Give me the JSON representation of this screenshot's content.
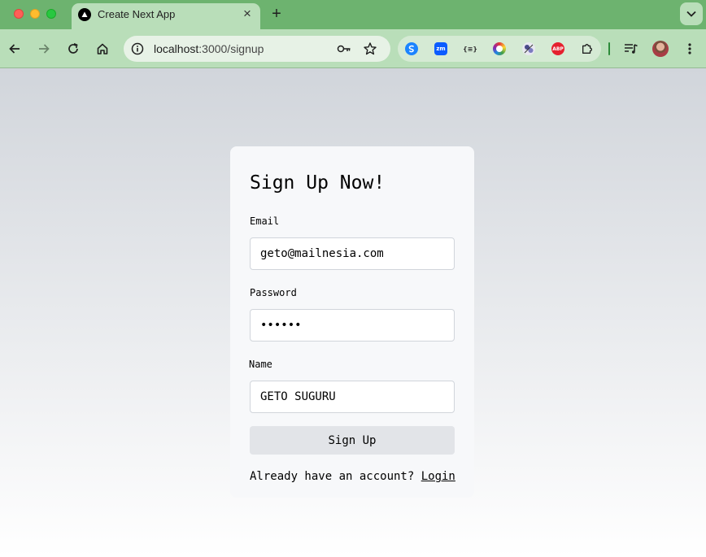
{
  "browser": {
    "tab_title": "Create Next App",
    "tab_close": "×",
    "new_tab": "+",
    "url_host": "localhost",
    "url_path": ":3000/signup",
    "icons": [
      "back-icon",
      "forward-icon",
      "reload-icon",
      "home-icon",
      "site-info-icon",
      "password-key-icon",
      "bookmark-star-icon",
      "extensions-puzzle-icon",
      "reading-list-icon",
      "tab-search-icon"
    ],
    "extensions": [
      {
        "name": "sync-ext-icon",
        "text": "S",
        "color": "#1b84ff"
      },
      {
        "name": "zoom-ext-icon",
        "text": "zm",
        "color": "#0b5cff"
      },
      {
        "name": "json-ext-icon",
        "text": "{≡}",
        "color": "#333333"
      },
      {
        "name": "color-picker-ext-icon",
        "text": "",
        "color": "#7a3bd1"
      },
      {
        "name": "scholar-ext-icon",
        "text": "",
        "color": "#555555"
      },
      {
        "name": "adblock-ext-icon",
        "text": "ABP",
        "color": "#e5202e"
      }
    ]
  },
  "form": {
    "title": "Sign Up Now!",
    "email_label": "Email",
    "email_value": "geto@mailnesia.com",
    "password_label": "Password",
    "password_value": "dummy1",
    "name_label": "Name",
    "name_value": "GETO SUGURU",
    "submit_label": "Sign Up",
    "footer_text": "Already have an account? ",
    "login_link": "Login"
  }
}
